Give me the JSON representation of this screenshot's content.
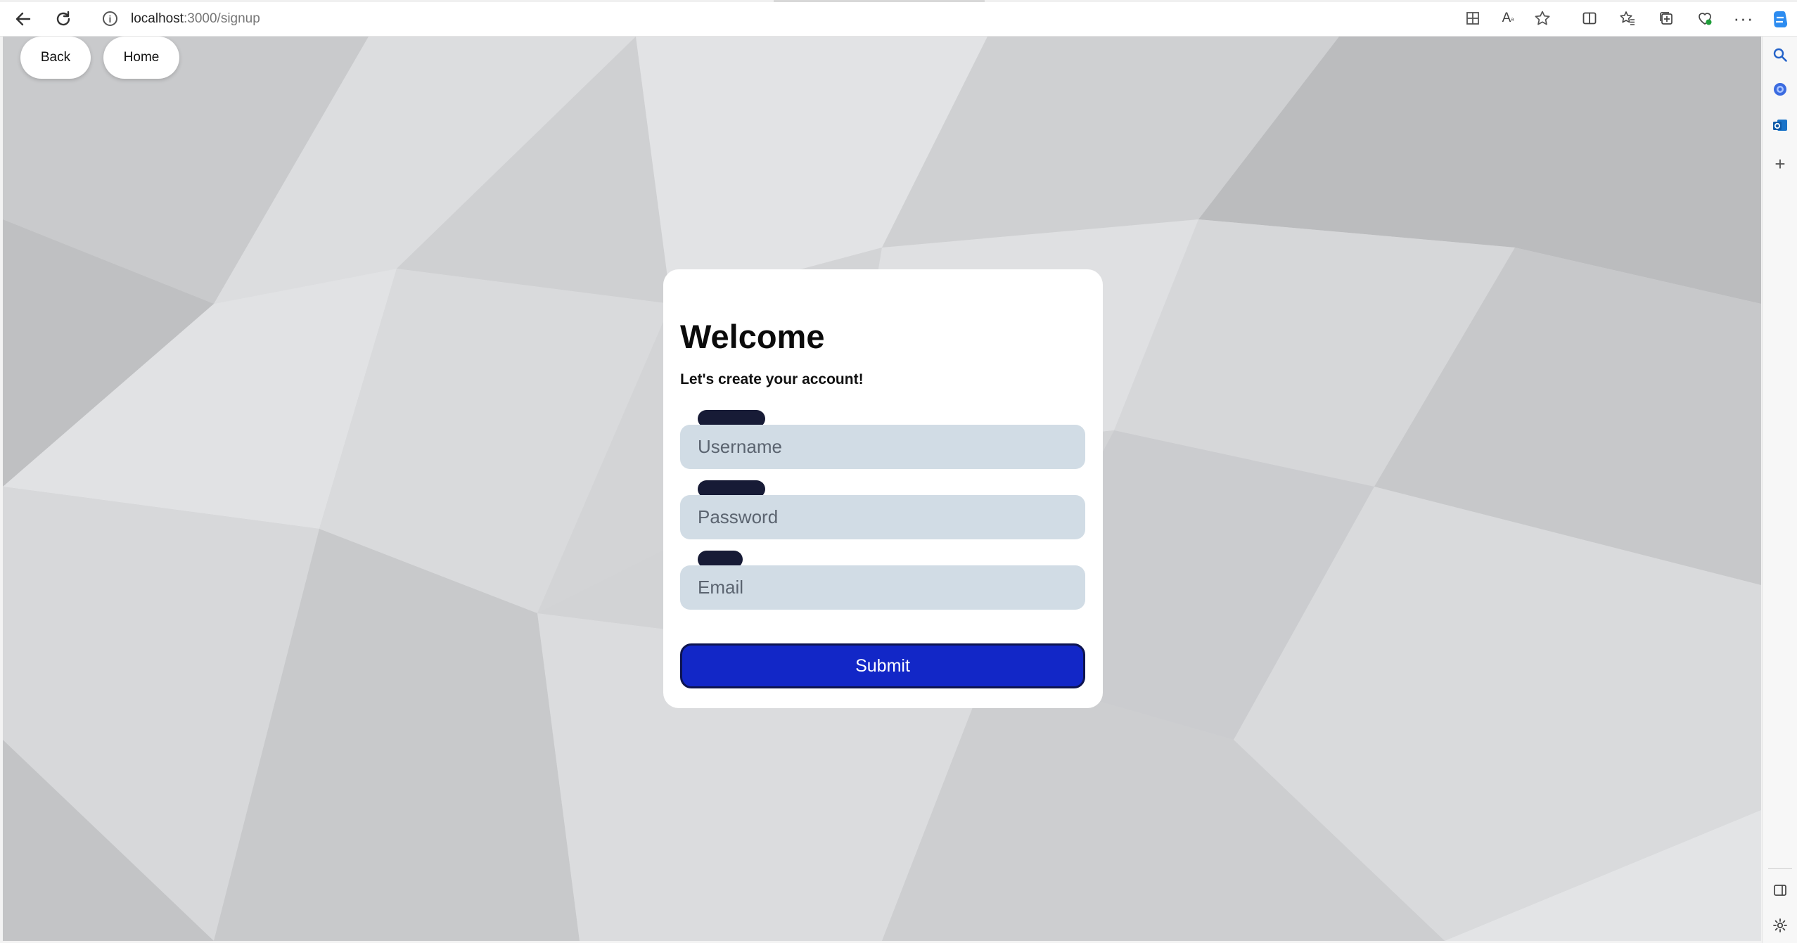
{
  "browser": {
    "url_host": "localhost",
    "url_path": ":3000/signup"
  },
  "page": {
    "nav": {
      "back_label": "Back",
      "home_label": "Home"
    },
    "card": {
      "title": "Welcome",
      "subtitle": "Let's create your account!",
      "fields": [
        {
          "placeholder": "Username"
        },
        {
          "placeholder": "Password"
        },
        {
          "placeholder": "Email"
        }
      ],
      "submit_label": "Submit"
    }
  },
  "colors": {
    "submit_bg": "#1227c7",
    "field_bg": "#d1dce5",
    "tag_bg": "#171b36"
  }
}
